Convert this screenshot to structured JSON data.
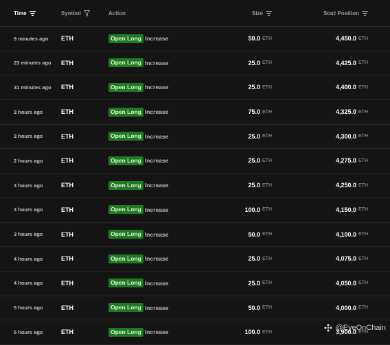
{
  "header": {
    "time": "Time",
    "symbol": "Symbol",
    "action": "Action",
    "size": "Size",
    "start_position": "Start Position"
  },
  "rows": [
    {
      "time": "9 minutes ago",
      "symbol": "ETH",
      "badge": "Open Long",
      "action": "Increase",
      "size": "50.0",
      "size_unit": "ETH",
      "position": "4,450.0",
      "position_unit": "ETH"
    },
    {
      "time": "23 minutes ago",
      "symbol": "ETH",
      "badge": "Open Long",
      "action": "Increase",
      "size": "25.0",
      "size_unit": "ETH",
      "position": "4,425.0",
      "position_unit": "ETH"
    },
    {
      "time": "31 minutes ago",
      "symbol": "ETH",
      "badge": "Open Long",
      "action": "Increase",
      "size": "25.0",
      "size_unit": "ETH",
      "position": "4,400.0",
      "position_unit": "ETH"
    },
    {
      "time": "2 hours ago",
      "symbol": "ETH",
      "badge": "Open Long",
      "action": "Increase",
      "size": "75.0",
      "size_unit": "ETH",
      "position": "4,325.0",
      "position_unit": "ETH"
    },
    {
      "time": "2 hours ago",
      "symbol": "ETH",
      "badge": "Open Long",
      "action": "Increase",
      "size": "25.0",
      "size_unit": "ETH",
      "position": "4,300.0",
      "position_unit": "ETH"
    },
    {
      "time": "2 hours ago",
      "symbol": "ETH",
      "badge": "Open Long",
      "action": "Increase",
      "size": "25.0",
      "size_unit": "ETH",
      "position": "4,275.0",
      "position_unit": "ETH"
    },
    {
      "time": "3 hours ago",
      "symbol": "ETH",
      "badge": "Open Long",
      "action": "Increase",
      "size": "25.0",
      "size_unit": "ETH",
      "position": "4,250.0",
      "position_unit": "ETH"
    },
    {
      "time": "3 hours ago",
      "symbol": "ETH",
      "badge": "Open Long",
      "action": "Increase",
      "size": "100.0",
      "size_unit": "ETH",
      "position": "4,150.0",
      "position_unit": "ETH"
    },
    {
      "time": "3 hours ago",
      "symbol": "ETH",
      "badge": "Open Long",
      "action": "Increase",
      "size": "50.0",
      "size_unit": "ETH",
      "position": "4,100.0",
      "position_unit": "ETH"
    },
    {
      "time": "4 hours ago",
      "symbol": "ETH",
      "badge": "Open Long",
      "action": "Increase",
      "size": "25.0",
      "size_unit": "ETH",
      "position": "4,075.0",
      "position_unit": "ETH"
    },
    {
      "time": "4 hours ago",
      "symbol": "ETH",
      "badge": "Open Long",
      "action": "Increase",
      "size": "25.0",
      "size_unit": "ETH",
      "position": "4,050.0",
      "position_unit": "ETH"
    },
    {
      "time": "5 hours ago",
      "symbol": "ETH",
      "badge": "Open Long",
      "action": "Increase",
      "size": "50.0",
      "size_unit": "ETH",
      "position": "4,000.0",
      "position_unit": "ETH"
    },
    {
      "time": "5 hours ago",
      "symbol": "ETH",
      "badge": "Open Long",
      "action": "Increase",
      "size": "100.0",
      "size_unit": "ETH",
      "position": "3,900.0",
      "position_unit": "ETH"
    }
  ],
  "watermark": {
    "text": "@EyeOnChain"
  },
  "colors": {
    "background": "#141414",
    "badge": "#1f7a1f",
    "muted": "#7b7b7b"
  }
}
